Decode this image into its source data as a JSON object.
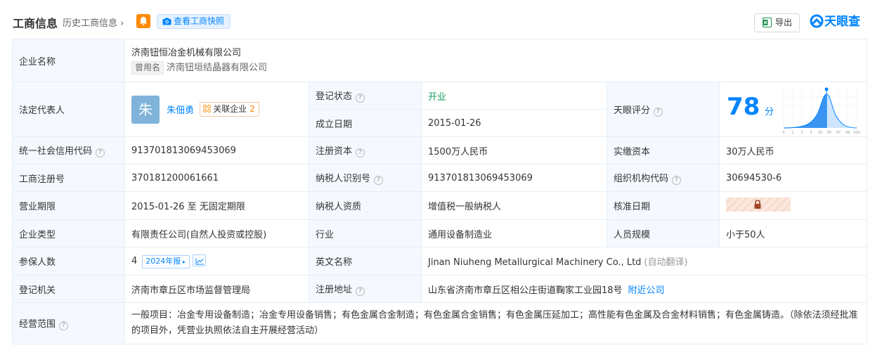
{
  "header": {
    "title": "工商信息",
    "history_link": "历史工商信息",
    "snapshot_button": "查看工商快照",
    "export_button": "导出",
    "logo_text": "天眼查"
  },
  "rows": {
    "company_name_label": "企业名称",
    "company_name": "济南钮恒冶金机械有限公司",
    "former_name_tag": "曾用名",
    "former_name": "济南钮垣结晶器有限公司",
    "legal_rep_label": "法定代表人",
    "legal_rep_avatar": "朱",
    "legal_rep_name": "朱佃勇",
    "related_label": "关联企业",
    "related_count": "2",
    "reg_status_label": "登记状态",
    "reg_status": "开业",
    "found_date_label": "成立日期",
    "found_date": "2015-01-26",
    "score_label": "天眼评分",
    "score_value": "78",
    "score_unit": "分",
    "credit_code_label": "统一社会信用代码",
    "credit_code": "913701813069453069",
    "reg_capital_label": "注册资本",
    "reg_capital": "1500万人民币",
    "paid_capital_label": "实缴资本",
    "paid_capital": "30万人民币",
    "reg_no_label": "工商注册号",
    "reg_no": "370181200061661",
    "taxpayer_id_label": "纳税人识别号",
    "taxpayer_id": "913701813069453069",
    "org_code_label": "组织机构代码",
    "org_code": "30694530-6",
    "term_label": "营业期限",
    "term": "2015-01-26 至 无固定期限",
    "taxpayer_qual_label": "纳税人资质",
    "taxpayer_qual": "增值税一般纳税人",
    "approve_date_label": "核准日期",
    "type_label": "企业类型",
    "type": "有限责任公司(自然人投资或控股)",
    "industry_label": "行业",
    "industry": "通用设备制造业",
    "staff_label": "人员规模",
    "staff": "小于50人",
    "insured_label": "参保人数",
    "insured": "4",
    "insured_year": "2024年报",
    "english_label": "英文名称",
    "english": "Jinan Niuheng Metallurgical Machinery Co., Ltd",
    "english_note": "(自动翻译)",
    "authority_label": "登记机关",
    "authority": "济南市章丘区市场监督管理局",
    "address_label": "注册地址",
    "address": "山东省济南市章丘区相公庄街道鞠家工业园18号",
    "nearby": "附近公司",
    "scope_label": "经营范围",
    "scope": "一般项目：冶金专用设备制造；冶金专用设备销售；有色金属合金制造；有色金属合金销售；有色金属压延加工；高性能有色金属及合金材料销售；有色金属铸造。（除依法须经批准的项目外，凭营业执照依法自主开展经营活动）"
  },
  "score_axis": [
    "0",
    "1",
    "3",
    "5",
    "50",
    "85",
    "97",
    "99",
    "100"
  ]
}
